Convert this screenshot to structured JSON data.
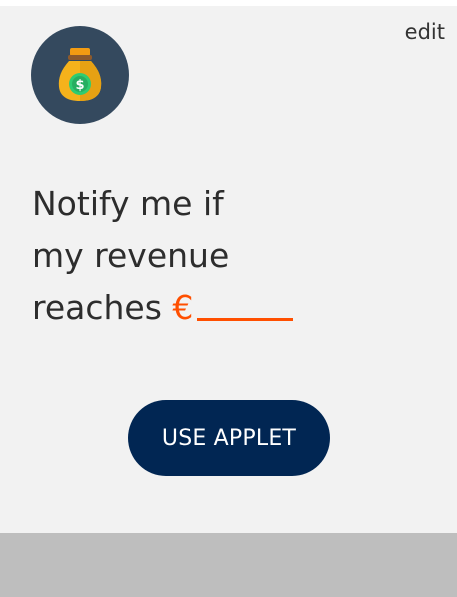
{
  "card": {
    "edit_label": "edit",
    "icon": "money-bag-icon",
    "headline_line1": "Notify me if",
    "headline_line2": "my revenue",
    "headline_line3": "reaches",
    "currency_symbol": "€",
    "button_label": "USE APPLET"
  },
  "colors": {
    "background": "#f2f2f2",
    "avatar": "#34495e",
    "accent": "#ff4f00",
    "button": "#012653",
    "footer": "#bebebe"
  }
}
